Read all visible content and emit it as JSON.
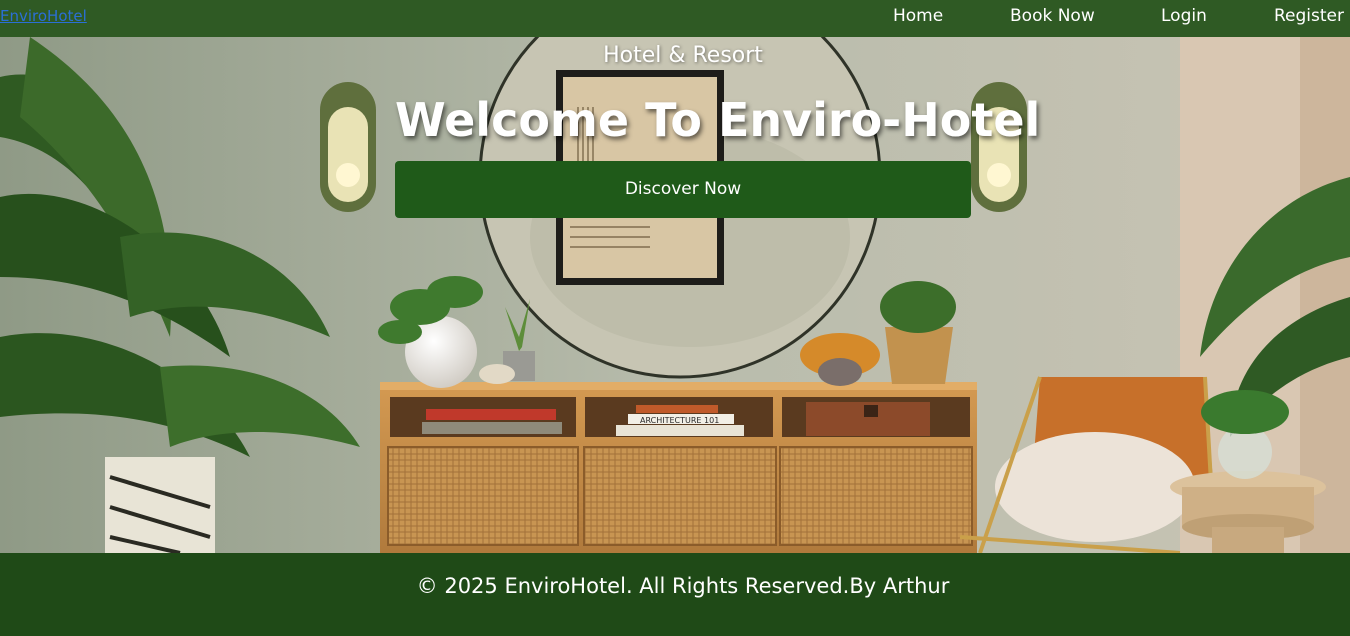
{
  "nav": {
    "brand": "EnviroHotel",
    "links": [
      "Home",
      "Book Now",
      "Login",
      "Register"
    ]
  },
  "hero": {
    "subtitle": "Hotel & Resort",
    "title": "Welcome To Enviro-Hotel",
    "cta_label": "Discover Now",
    "book_spines": [
      "ARCHITECTURE 101"
    ]
  },
  "footer": {
    "text": "© 2025 EnviroHotel. All Rights Reserved.By Arthur"
  },
  "colors": {
    "navbar": "#2f5a24",
    "footer": "#1f4a17",
    "button": "#1f5a19",
    "brand_link": "#2b6fd6"
  }
}
